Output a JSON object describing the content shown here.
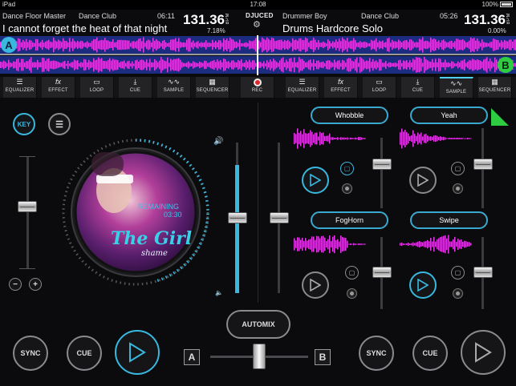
{
  "status": {
    "device": "iPad",
    "time": "17:08",
    "battery": "100%"
  },
  "deckA": {
    "artist": "Dance Floor Master",
    "album": "Dance Club",
    "time": "06:11",
    "bpm": "131.36",
    "bpm_unit": "BPM",
    "pitch": "7.18%",
    "title": "I cannot forget the heat of that night",
    "letter": "A"
  },
  "deckB": {
    "artist": "Drummer Boy",
    "album": "Dance Club",
    "time": "05:26",
    "bpm": "131.36",
    "bpm_unit": "BPM",
    "pitch": "0.00%",
    "title": "Drums Hardcore Solo",
    "letter": "B"
  },
  "logo": "DJUCED",
  "toolbar_left": [
    "EQUALIZER",
    "EFFECT",
    "LOOP",
    "CUE",
    "SAMPLE",
    "SEQUENCER"
  ],
  "toolbar_rec": "REC",
  "toolbar_right": [
    "EQUALIZER",
    "EFFECT",
    "LOOP",
    "CUE",
    "SAMPLE",
    "SEQUENCER"
  ],
  "key_label": "KEY",
  "platter": {
    "remaining_label": "REMAINING",
    "remaining_time": "03:30",
    "art_text_1": "The Girl",
    "art_text_2": "shame"
  },
  "samples": [
    {
      "name": "Whobble"
    },
    {
      "name": "Yeah"
    },
    {
      "name": "FogHorn"
    },
    {
      "name": "Swipe"
    }
  ],
  "automix_label": "AUTOMIX",
  "bottom": {
    "sync": "SYNC",
    "cue": "CUE",
    "cross_a": "A",
    "cross_b": "B"
  },
  "pitch_minus": "−",
  "pitch_plus": "+",
  "colors": {
    "accent": "#39b8df",
    "deck_b": "#2ecc40",
    "waveform": "#e23ce6"
  },
  "levels": {
    "pitch_slider": 0.55,
    "volume_a": 0.5,
    "volume_b": 0.5,
    "crossfader": 0.5,
    "vu_a": 0.85
  }
}
